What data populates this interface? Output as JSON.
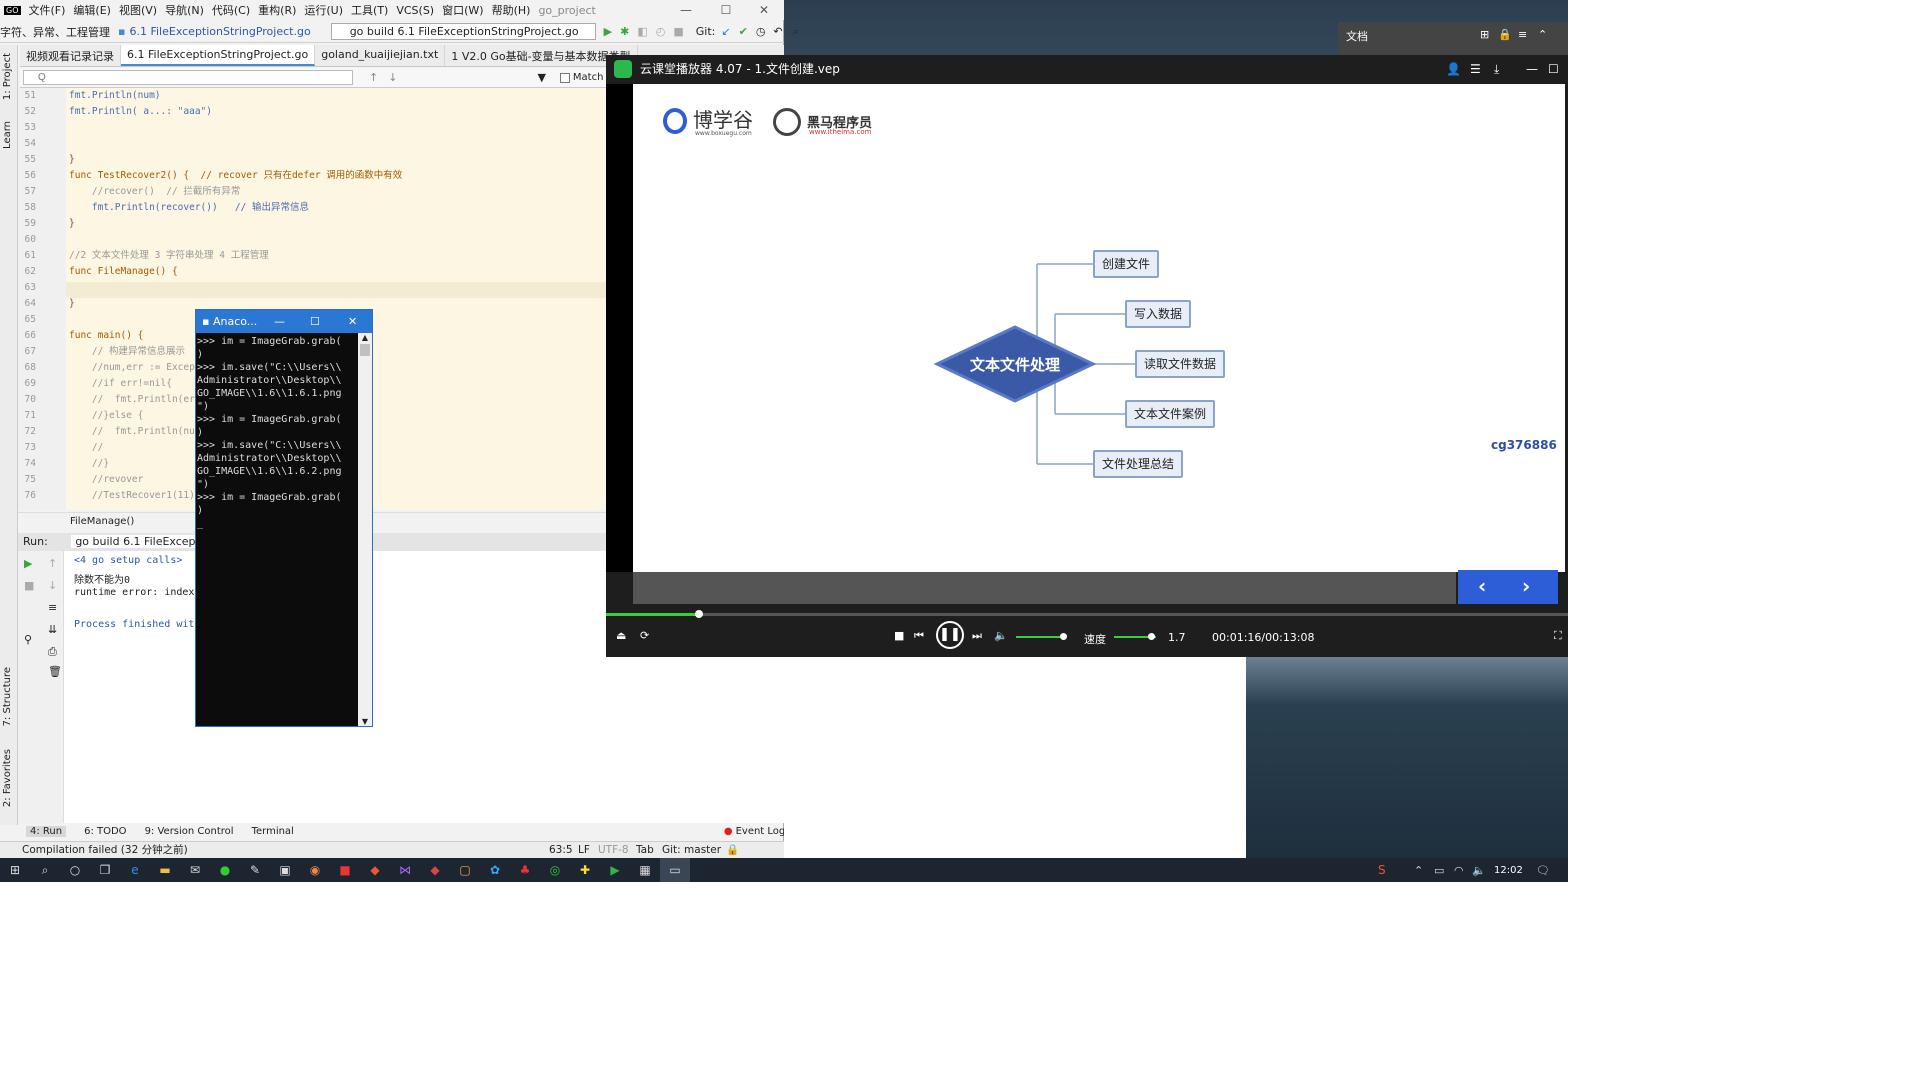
{
  "ide": {
    "menu": [
      "文件(F)",
      "编辑(E)",
      "视图(V)",
      "导航(N)",
      "代码(C)",
      "重构(R)",
      "运行(U)",
      "工具(T)",
      "VCS(S)",
      "窗口(W)",
      "帮助(H)"
    ],
    "project": "go_project",
    "nav_prefix": "字符、异常、工程管理",
    "nav_file": "6.1 FileExceptionStringProject.go",
    "run_config": "go build 6.1 FileExceptionStringProject.go",
    "git_label": "Git:",
    "tabs": [
      "视频观看记录记录",
      "6.1 FileExceptionStringProject.go",
      "goland_kuaijiejian.txt",
      "1 V2.0 Go基础-变量与基本数据类型"
    ],
    "search_placeholder": "Q",
    "match_case": "Match Ca",
    "side_labels": {
      "project": "1: Project",
      "learn": "Learn",
      "structure": "7: Structure",
      "favorites": "2: Favorites"
    },
    "line_numbers": [
      "51",
      "52",
      "53",
      "54",
      "55",
      "56",
      "57",
      "58",
      "59",
      "60",
      "61",
      "62",
      "63",
      "64",
      "65",
      "66",
      "67",
      "68",
      "69",
      "70",
      "71",
      "72",
      "73",
      "74",
      "75",
      "76"
    ],
    "code_lines": [
      "fmt.Println(num)",
      "fmt.Println( a...: \"aaa\")",
      "",
      "",
      "}",
      "func TestRecover2() {  // recover 只有在defer 调用的函数中有效",
      "    //recover()  // 拦截所有异常",
      "    fmt.Println(recover())   // 输出异常信息",
      "}",
      "",
      "//2 文本文件处理 3 字符串处理 4 工程管理",
      "func FileManage() {",
      "",
      "}",
      "",
      "func main() {",
      "    // 构建异常信息展示",
      "    //num,err := Excep",
      "    //if err!=nil{",
      "    //  fmt.Println(er",
      "    //}else {",
      "    //  fmt.Println(nu",
      "    //",
      "    //}",
      "    //revover",
      "    //TestRecover1(11)"
    ],
    "breadcrumb": "FileManage()",
    "run_label": "Run:",
    "run_tab": "go build 6.1 FileException",
    "run_output": [
      "<4 go setup calls>",
      "除数不能为0",
      "runtime error: index",
      "",
      "Process finished with"
    ],
    "toolwindows": [
      "4: Run",
      "6: TODO",
      "9: Version Control",
      "Terminal"
    ],
    "event_log": "Event Log",
    "status_left": "Compilation failed (32 分钟之前)",
    "status_right": [
      "63:5",
      "LF",
      "UTF-8",
      "Tab",
      "Git: master"
    ]
  },
  "terminal": {
    "title": "Anaco...",
    "lines": [
      ">>> im = ImageGrab.grab(",
      ")",
      ">>> im.save(\"C:\\\\Users\\\\",
      "Administrator\\\\Desktop\\\\",
      "GO_IMAGE\\\\1.6\\\\1.6.1.png",
      "\")",
      ">>> im = ImageGrab.grab(",
      ")",
      ">>> im.save(\"C:\\\\Users\\\\",
      "Administrator\\\\Desktop\\\\",
      "GO_IMAGE\\\\1.6\\\\1.6.2.png",
      "\")",
      ">>> im = ImageGrab.grab(",
      ")",
      "_"
    ]
  },
  "player": {
    "title": "云课堂播放器 4.07 - 1.文件创建.vep",
    "logo1": "博学谷",
    "logo1_url": "www.boxuegu.com",
    "logo2": "黑马程序员",
    "logo2_url": "www.itheima.com",
    "center_node": "文本文件处理",
    "nodes": [
      "创建文件",
      "写入数据",
      "读取文件数据",
      "文本文件案例",
      "文件处理总结"
    ],
    "watermark": "cg376886",
    "speed_label": "速度",
    "speed_value": "1.7",
    "time": "00:01:16/00:13:08",
    "progress": 0.097,
    "colors": {
      "accent": "#2d5ed8",
      "diamond": "#3a5aa8",
      "progress": "#3ccc3c"
    }
  },
  "doc_panel": {
    "label": "文档"
  },
  "taskbar": {
    "clock": "12:02"
  }
}
